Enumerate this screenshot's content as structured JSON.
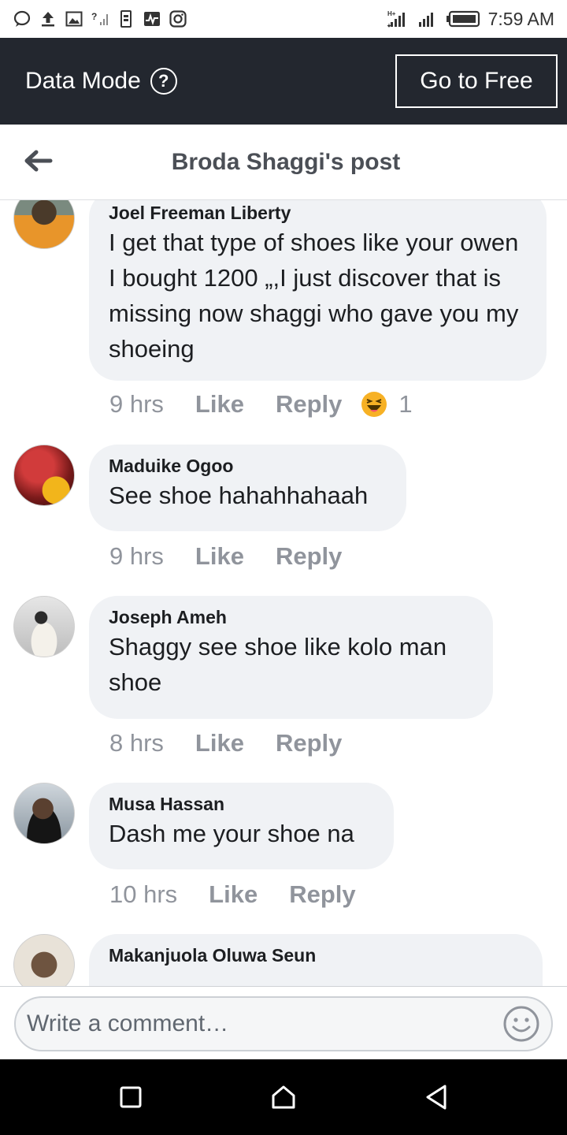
{
  "status_bar": {
    "time": "7:59 AM",
    "icons": [
      "chat-bubble-icon",
      "upload-icon",
      "image-icon",
      "signal-question-icon",
      "sim-icon",
      "activity-icon",
      "instagram-icon",
      "network-h-plus-icon",
      "signal-icon",
      "battery-icon"
    ]
  },
  "data_mode": {
    "label": "Data Mode",
    "help_icon": "?",
    "button_label": "Go to Free"
  },
  "header": {
    "title": "Broda Shaggi's post",
    "back_icon": "arrow-left-icon"
  },
  "comments": [
    {
      "author": "Joel Freeman Liberty",
      "text": "I get that type of shoes like your owen I bought 1200 „,I just discover that is missing now shaggi who gave you my shoeing",
      "time": "9 hrs",
      "like": "Like",
      "reply": "Reply",
      "reaction_count": "1",
      "reaction_icon": "haha-emoji-icon"
    },
    {
      "author": "Maduike Ogoo",
      "text": "See shoe hahahhahaah",
      "time": "9 hrs",
      "like": "Like",
      "reply": "Reply"
    },
    {
      "author": "Joseph Ameh",
      "text": "Shaggy see shoe like kolo man shoe",
      "time": "8 hrs",
      "like": "Like",
      "reply": "Reply"
    },
    {
      "author": "Musa Hassan",
      "text": "Dash me your shoe na",
      "time": "10 hrs",
      "like": "Like",
      "reply": "Reply"
    },
    {
      "author": "Makanjuola Oluwa Seun"
    }
  ],
  "comment_input": {
    "placeholder": "Write a comment…",
    "emoji_icon": "smiley-icon"
  },
  "nav_bar": {
    "icons": [
      "recents-square-icon",
      "home-icon",
      "back-triangle-icon"
    ]
  },
  "colors": {
    "data_bar_bg": "#23272f",
    "bubble_bg": "#f0f2f5",
    "meta_text": "#90949c",
    "title_text": "#4b4f56"
  }
}
